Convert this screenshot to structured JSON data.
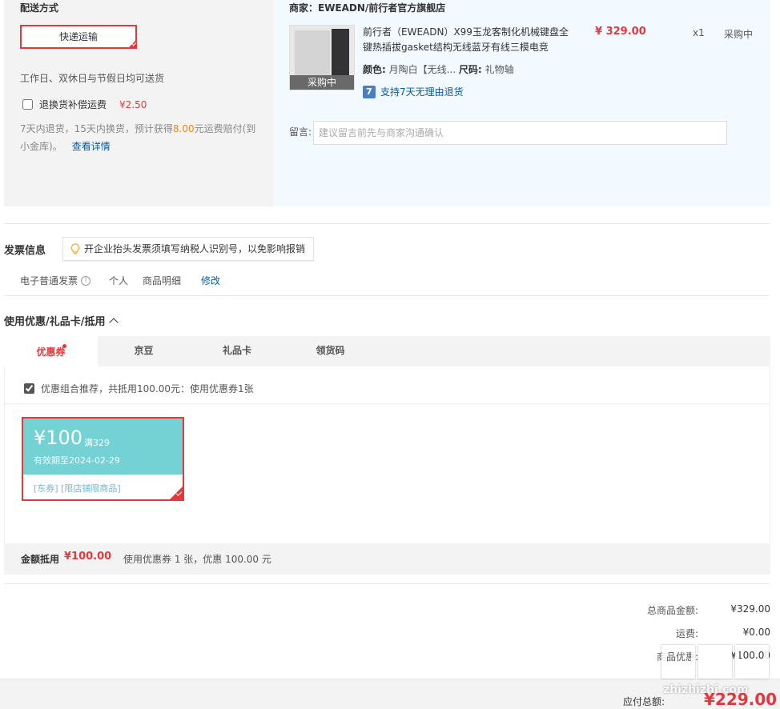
{
  "shipping": {
    "title": "配送方式",
    "method": "快递运输",
    "delivery_note": "工作日、双休日与节假日均可送货",
    "return_insurance_label": "退换货补偿运费",
    "return_insurance_price": "¥2.50",
    "return_desc_pre": "7天内退货，15天内换货，预计获得",
    "return_desc_amount": "8.00",
    "return_desc_post": "元运费赔付(到小金库)。",
    "return_desc_link": "查看详情"
  },
  "shop": {
    "name": "商家：EWEADN/前行者官方旗舰店",
    "product_title": "前行者（EWEADN）X99玉龙客制化机械键盘全键热插拔gasket结构无线蓝牙有线三模电竞",
    "image_tag": "采购中",
    "price": "¥ 329.00",
    "qty": "x1",
    "status": "采购中",
    "color_label": "颜色:",
    "color_value": "月陶白【无线...",
    "size_label": "尺码:",
    "size_value": "礼物轴",
    "return_badge": "7",
    "return_policy": "支持7天无理由退货",
    "message_label": "留言:",
    "message_placeholder": "建议留言前先与商家沟通确认"
  },
  "invoice": {
    "title": "发票信息",
    "tip": "开企业抬头发票须填写纳税人识别号，以免影响报销",
    "type": "电子普通发票",
    "info_glyph": "!",
    "personal": "个人",
    "detail": "商品明细",
    "edit": "修改"
  },
  "coupons": {
    "title": "使用优惠/礼品卡/抵用",
    "tabs": [
      {
        "label": "优惠券"
      },
      {
        "label": "京豆"
      },
      {
        "label": "礼品卡"
      },
      {
        "label": "领货码"
      }
    ],
    "combo_text": "优惠组合推荐，共抵用100.00元：使用优惠券1张",
    "coupon": {
      "amount": "¥100",
      "condition": "满329",
      "valid": "有效期至2024-02-29",
      "scope": "[东券] [限店铺限商品]"
    },
    "summary_label": "金额抵用",
    "summary_amount": "¥100.00",
    "summary_desc": "使用优惠券 1 张，优惠 100.00 元"
  },
  "totals": {
    "goods_label": "总商品金额:",
    "goods_value": "¥329.00",
    "shipping_label": "运费:",
    "shipping_value": "¥0.00",
    "discount_label": "商品优惠:",
    "discount_value": "¥100.00",
    "pay_label": "应付总额:",
    "pay_value": "¥229.00"
  },
  "watermark": "zhizhizhi.com"
}
